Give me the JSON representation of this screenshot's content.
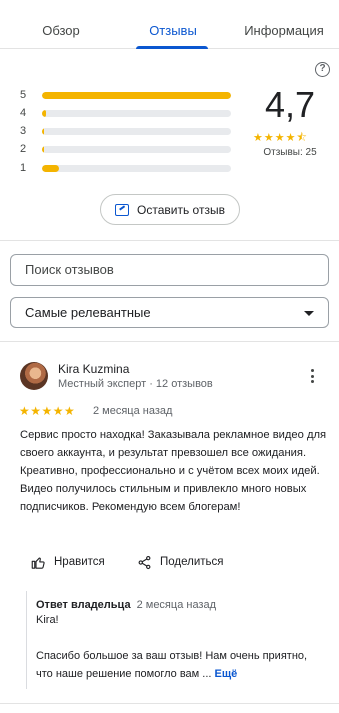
{
  "tabs": [
    {
      "label": "Обзор",
      "active": false
    },
    {
      "label": "Отзывы",
      "active": true
    },
    {
      "label": "Информация",
      "active": false
    }
  ],
  "help_icon": "help-circle-icon",
  "rating": {
    "distribution": [
      {
        "stars": "5",
        "fraction": 1.0
      },
      {
        "stars": "4",
        "fraction": 0.02
      },
      {
        "stars": "3",
        "fraction": 0.01
      },
      {
        "stars": "2",
        "fraction": 0.01
      },
      {
        "stars": "1",
        "fraction": 0.09
      }
    ],
    "score": "4,7",
    "stars_display": "★★★★⯪",
    "count_label": "Отзывы: 25",
    "accent_color": "#f4b400"
  },
  "write_review": {
    "label": "Оставить отзыв",
    "icon": "write-review-icon"
  },
  "search": {
    "placeholder": "Поиск отзывов"
  },
  "sort": {
    "selected": "Самые релевантные"
  },
  "review": {
    "author": "Kira Kuzmina",
    "meta": "Местный эксперт · 12 отзывов",
    "stars": "★★★★★",
    "date": "2 месяца назад",
    "text": "Сервис  просто находка! Заказывала рекламное видео для своего аккаунта, и результат превзошел все ожидания. Креативно, профессионально и с учётом всех моих идей. Видео получилось стильным и привлекло много новых подписчиков. Рекомендую всем блогерам!",
    "like_label": "Нравится",
    "share_label": "Поделиться",
    "reply": {
      "title": "Ответ владельца",
      "date": "2 месяца назад",
      "greeting": "Kira!",
      "text": "Спасибо большое за ваш отзыв! Нам очень приятно, что наше решение помогло вам ...",
      "more_label": "Ещё"
    }
  }
}
